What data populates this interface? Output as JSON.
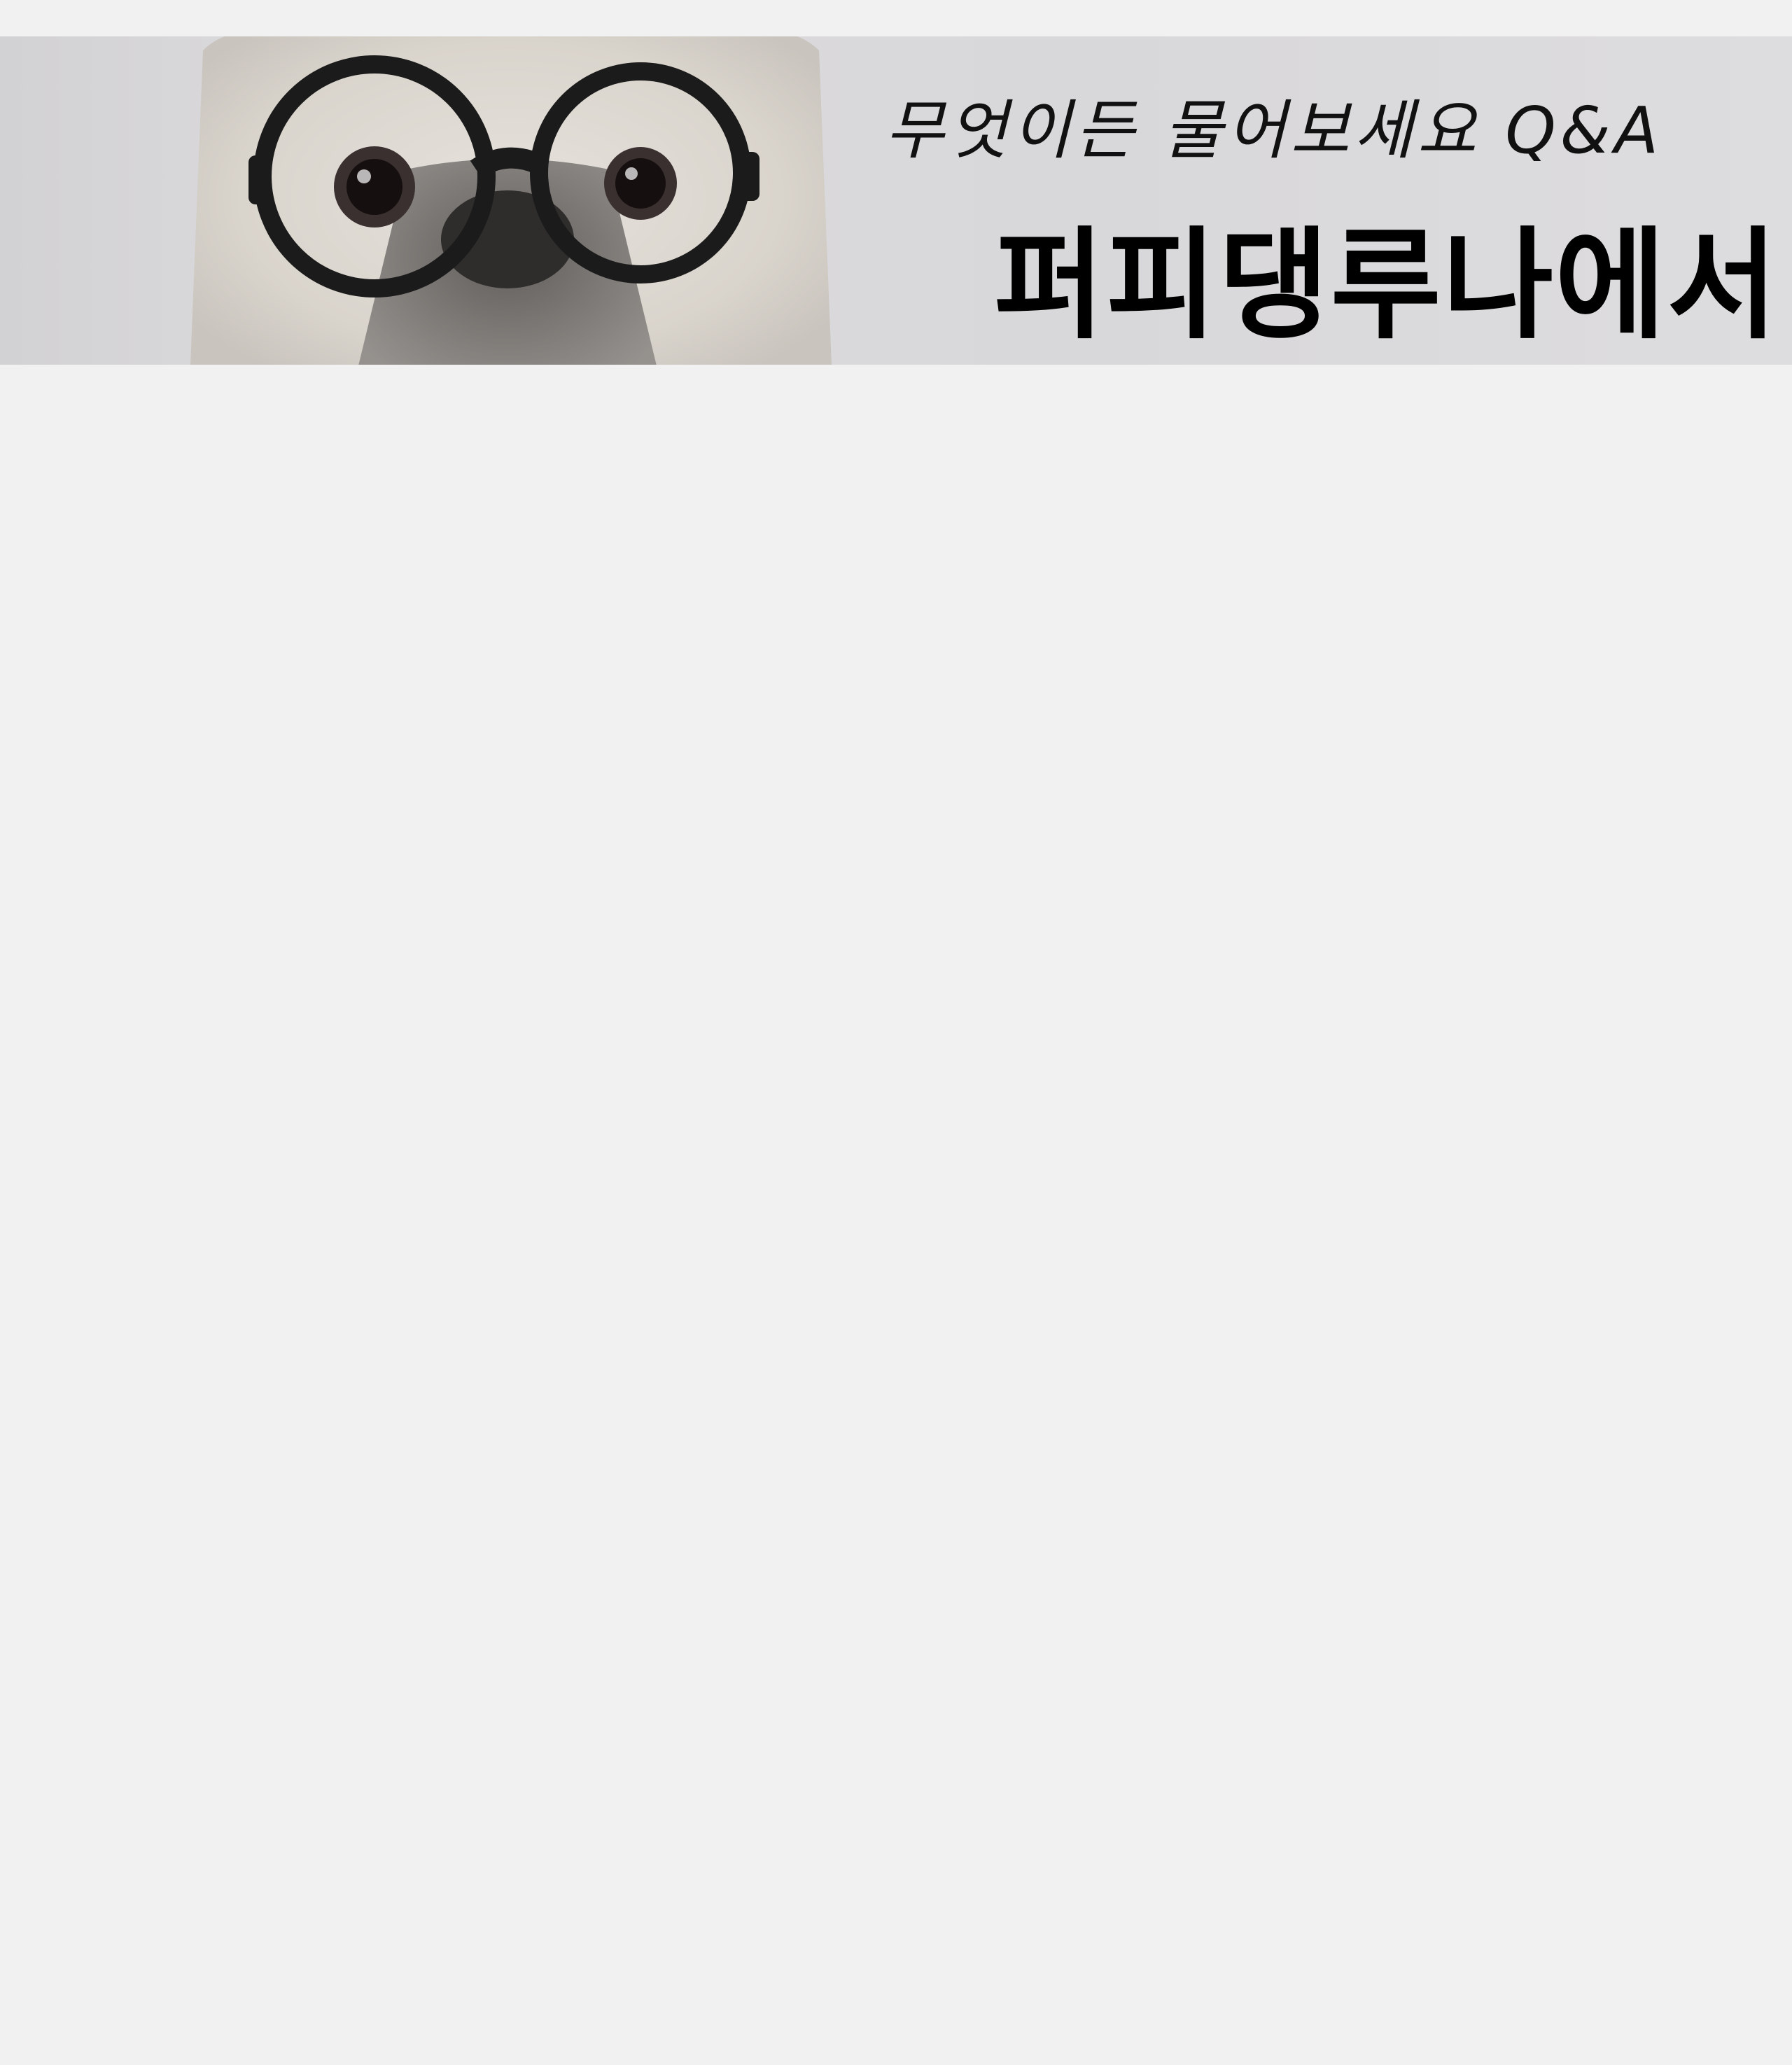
{
  "banner": {
    "subtitle": "무엇이든 물어보세요 Q&A",
    "title": "퍼피댕루나에서!!",
    "image": "dog-with-glasses"
  },
  "colors": {
    "page_background": "#f1f1f1",
    "banner_background": "#d8d7da",
    "text": "#000000"
  }
}
